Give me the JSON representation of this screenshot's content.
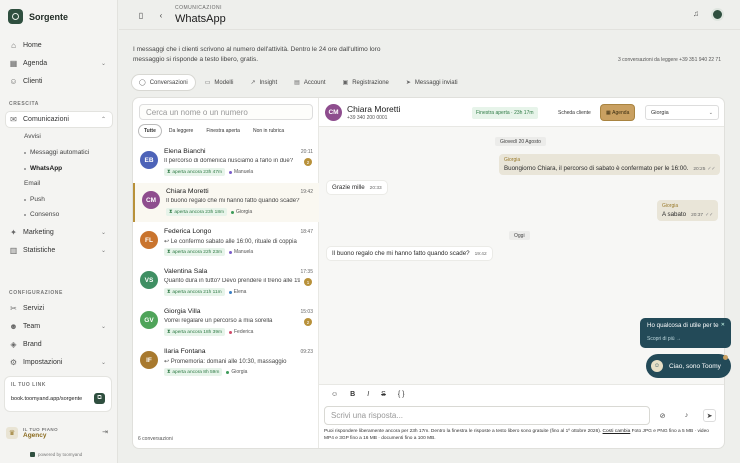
{
  "app": {
    "name": "Sorgente"
  },
  "sidebar": {
    "main": [
      {
        "label": "Home",
        "icon": "home-icon"
      },
      {
        "label": "Agenda",
        "icon": "calendar-icon"
      },
      {
        "label": "Clienti",
        "icon": "users-icon"
      }
    ],
    "crescita_label": "CRESCITA",
    "comunicazioni": {
      "label": "Comunicazioni",
      "items": [
        "Avvisi",
        "Messaggi automatici",
        "WhatsApp",
        "Email",
        "Push",
        "Consenso"
      ]
    },
    "growth": [
      {
        "label": "Marketing",
        "icon": "megaphone-icon"
      },
      {
        "label": "Statistiche",
        "icon": "chart-icon"
      }
    ],
    "config_label": "CONFIGURAZIONE",
    "config": [
      {
        "label": "Servizi",
        "icon": "scissors-icon"
      },
      {
        "label": "Team",
        "icon": "team-icon"
      },
      {
        "label": "Brand",
        "icon": "brand-icon"
      },
      {
        "label": "Impostazioni",
        "icon": "gear-icon"
      }
    ],
    "link": {
      "label": "IL TUO LINK",
      "url": "book.toomyand.app/sorgente"
    },
    "plan": {
      "label": "IL TUO PIANO",
      "name": "Agency"
    },
    "powered": "powered by toomyand"
  },
  "header": {
    "breadcrumb": "COMUNICAZIONI",
    "title": "WhatsApp"
  },
  "intro": {
    "description": "I messaggi che i clienti scrivono al numero dell'attività. Dentro le 24 ore dall'ultimo loro messaggio si risponde a testo libero, gratis.",
    "meta": "3 conversazioni da leggere   +39 351 940 22 71"
  },
  "tabs": [
    {
      "label": "Conversazioni",
      "icon": "chat-icon"
    },
    {
      "label": "Modelli",
      "icon": "template-icon"
    },
    {
      "label": "Insight",
      "icon": "insight-icon"
    },
    {
      "label": "Account",
      "icon": "account-icon"
    },
    {
      "label": "Registrazione",
      "icon": "register-icon"
    },
    {
      "label": "Messaggi inviati",
      "icon": "send-icon"
    }
  ],
  "list": {
    "search_placeholder": "Cerca un nome o un numero",
    "filters": [
      "Tutte",
      "Da leggere",
      "Finestra aperta",
      "Non in rubrica"
    ],
    "footer": "6 conversazioni",
    "conversations": [
      {
        "initials": "EB",
        "name": "Elena Bianchi",
        "time": "20:11",
        "preview": "Il percorso di domenica riusciamo a farlo in due?",
        "unread": "2",
        "status": "aperta ancora 23h 47m",
        "staff": "Manuela",
        "color": "#4d63b8",
        "staff_color": "#7a5cc9"
      },
      {
        "initials": "CM",
        "name": "Chiara Moretti",
        "time": "19:42",
        "preview": "Il buono regalo che mi hanno fatto quando scade?",
        "unread": "",
        "status": "aperta ancora 23h 18m",
        "staff": "Giorgia",
        "color": "#8e4d8e",
        "staff_color": "#3d9b5a"
      },
      {
        "initials": "FL",
        "name": "Federica Longo",
        "time": "18:47",
        "preview": "↩ Le confermo sabato alle 16:00, rituale di coppia",
        "unread": "",
        "status": "aperta ancora 22h 23m",
        "staff": "Manuela",
        "color": "#c9742e",
        "staff_color": "#7a5cc9"
      },
      {
        "initials": "VS",
        "name": "Valentina Sala",
        "time": "17:35",
        "preview": "Quanto dura in tutto? Devo prendere il treno alle 19",
        "unread": "1",
        "status": "aperta ancora 21h 11m",
        "staff": "Elena",
        "color": "#3f8f63",
        "staff_color": "#3a7fc4"
      },
      {
        "initials": "GV",
        "name": "Giorgia Villa",
        "time": "15:03",
        "preview": "Vorrei regalare un percorso a mia sorella",
        "unread": "2",
        "status": "aperta ancora 18h 39m",
        "staff": "Federica",
        "color": "#4fa45a",
        "staff_color": "#d04a6a"
      },
      {
        "initials": "IF",
        "name": "Ilaria Fontana",
        "time": "09:23",
        "preview": "↩ Promemoria: domani alle 10:30, massaggio",
        "unread": "",
        "status": "aperta ancora 8h 59m",
        "staff": "Giorgia",
        "color": "#a8792e",
        "staff_color": "#3d9b5a"
      }
    ]
  },
  "chat": {
    "name": "Chiara Moretti",
    "initials": "CM",
    "phone": "+39 340 200 0001",
    "window": "Finestra aperta · 23h 17m",
    "client_btn": "Scheda cliente",
    "agenda_btn": "Agenda",
    "assignee": "Giorgia",
    "messages": {
      "day1": "Giovedì 20 Agosto",
      "m1_sender": "Giorgia",
      "m1_text": "Buongiorno Chiara, il percorso di sabato è confermato per le 16:00.",
      "m1_time": "20:25",
      "m2_text": "Grazie mille",
      "m2_time": "20:33",
      "m3_sender": "Giorgia",
      "m3_text": "A sabato",
      "m3_time": "20:37",
      "day2": "Oggi",
      "m4_text": "Il buono regalo che mi hanno fatto quando scade?",
      "m4_time": "19:42"
    },
    "composer": {
      "placeholder": "Scrivi una risposta...",
      "note": "Puoi rispondere liberamente ancora per 23h 17m. Dentro la finestra le risposte a testo libero sono gratuite (fino al 1º ottobre 2026).",
      "note_link": "Costi cambia",
      "note_tail": "Foto JPG e PNG fino a 5 MB · video MP4 e 3GP fino a 16 MB · documenti fino a 100 MB."
    }
  },
  "toomy": {
    "question": "Ho qualcosa di utile per te",
    "link": "Scopri di più →",
    "button": "Ciao, sono Toomy"
  }
}
